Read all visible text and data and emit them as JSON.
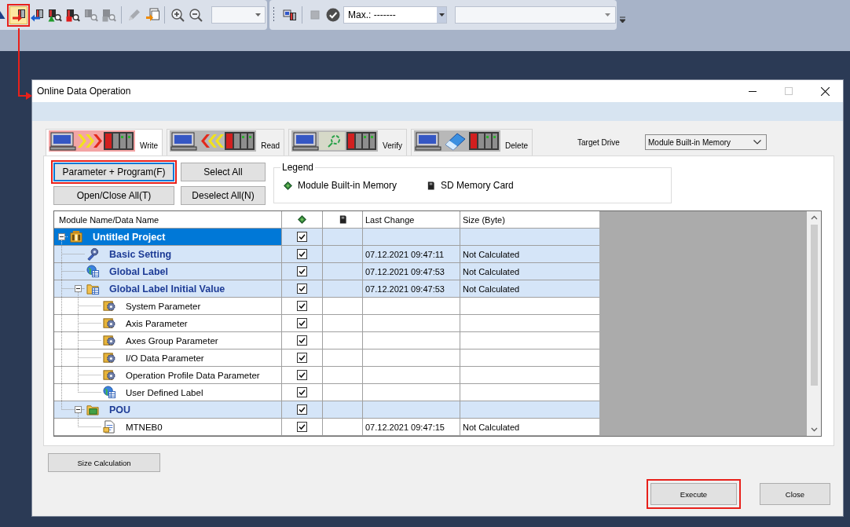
{
  "toolbar": {
    "buttons": [
      {
        "highlighted": true,
        "disabled": false
      },
      {
        "highlighted": false,
        "disabled": false
      },
      {
        "highlighted": false,
        "disabled": false
      },
      {
        "highlighted": false,
        "disabled": false
      },
      {
        "highlighted": false,
        "disabled": true
      },
      {
        "highlighted": false,
        "disabled": true
      },
      {
        "highlighted": false,
        "disabled": true
      },
      {
        "highlighted": false,
        "disabled": false
      },
      {
        "highlighted": false,
        "disabled": false
      },
      {
        "highlighted": false,
        "disabled": false
      },
      {
        "highlighted": false,
        "disabled": false
      },
      {
        "highlighted": false,
        "disabled": true
      },
      {
        "highlighted": false,
        "disabled": false
      }
    ],
    "max_field": {
      "value": "Max.: -------"
    }
  },
  "window": {
    "title": "Online Data Operation",
    "maximize_disabled": true
  },
  "tabs": [
    {
      "label": "Write",
      "kind": "write",
      "selected": true
    },
    {
      "label": "Read",
      "kind": "read",
      "selected": false
    },
    {
      "label": "Verify",
      "kind": "verify",
      "selected": false
    },
    {
      "label": "Delete",
      "kind": "delete",
      "selected": false
    }
  ],
  "target_drive": {
    "label": "Target Drive",
    "value": "Module Built-in Memory"
  },
  "action_buttons": [
    {
      "label": "Parameter + Program(F)",
      "highlighted": true,
      "focused": true
    },
    {
      "label": "Select All",
      "highlighted": false,
      "focused": false
    },
    {
      "label": "Open/Close All(T)",
      "highlighted": false,
      "focused": false
    },
    {
      "label": "Deselect All(N)",
      "highlighted": false,
      "focused": false
    }
  ],
  "legend": {
    "title": "Legend",
    "items": [
      {
        "label": "Module Built-in Memory"
      },
      {
        "label": "SD Memory Card"
      }
    ]
  },
  "tree": {
    "columns": {
      "name": "Module Name/Data Name",
      "last_change": "Last Change",
      "size": "Size (Byte)"
    },
    "rows": [
      {
        "name": "Untitled Project",
        "kind": "project",
        "selected": true,
        "checked": true,
        "expanded": true,
        "children": [
          {
            "name": "Basic Setting",
            "kind": "setting",
            "selected": false,
            "checked": true,
            "last_change": "07.12.2021 09:47:11",
            "size": "Not Calculated"
          },
          {
            "name": "Global Label",
            "kind": "label",
            "selected": false,
            "checked": true,
            "last_change": "07.12.2021 09:47:53",
            "size": "Not Calculated"
          },
          {
            "name": "Global Label Initial Value",
            "kind": "label-folder",
            "selected": false,
            "checked": true,
            "last_change": "07.12.2021 09:47:53",
            "size": "Not Calculated",
            "expanded": true,
            "children": [
              {
                "name": "System Parameter",
                "kind": "parameter",
                "selected": false,
                "checked": true
              },
              {
                "name": "Axis Parameter",
                "kind": "parameter",
                "selected": false,
                "checked": true
              },
              {
                "name": "Axes Group Parameter",
                "kind": "parameter",
                "selected": false,
                "checked": true
              },
              {
                "name": "I/O Data Parameter",
                "kind": "parameter",
                "selected": false,
                "checked": true
              },
              {
                "name": "Operation Profile Data Parameter",
                "kind": "parameter",
                "selected": false,
                "checked": true
              },
              {
                "name": "User Defined Label",
                "kind": "label",
                "selected": false,
                "checked": true
              }
            ]
          },
          {
            "name": "POU",
            "kind": "folder",
            "selected": false,
            "checked": true,
            "expanded": true,
            "children": [
              {
                "name": "MTNEB0",
                "kind": "program",
                "selected": false,
                "checked": true,
                "last_change": "07.12.2021 09:47:15",
                "size": "Not Calculated"
              }
            ]
          }
        ]
      }
    ]
  },
  "size_button": {
    "label": "Size Calculation"
  },
  "dialog_buttons": [
    {
      "label": "Execute",
      "highlighted": true
    },
    {
      "label": "Close",
      "highlighted": false
    }
  ]
}
